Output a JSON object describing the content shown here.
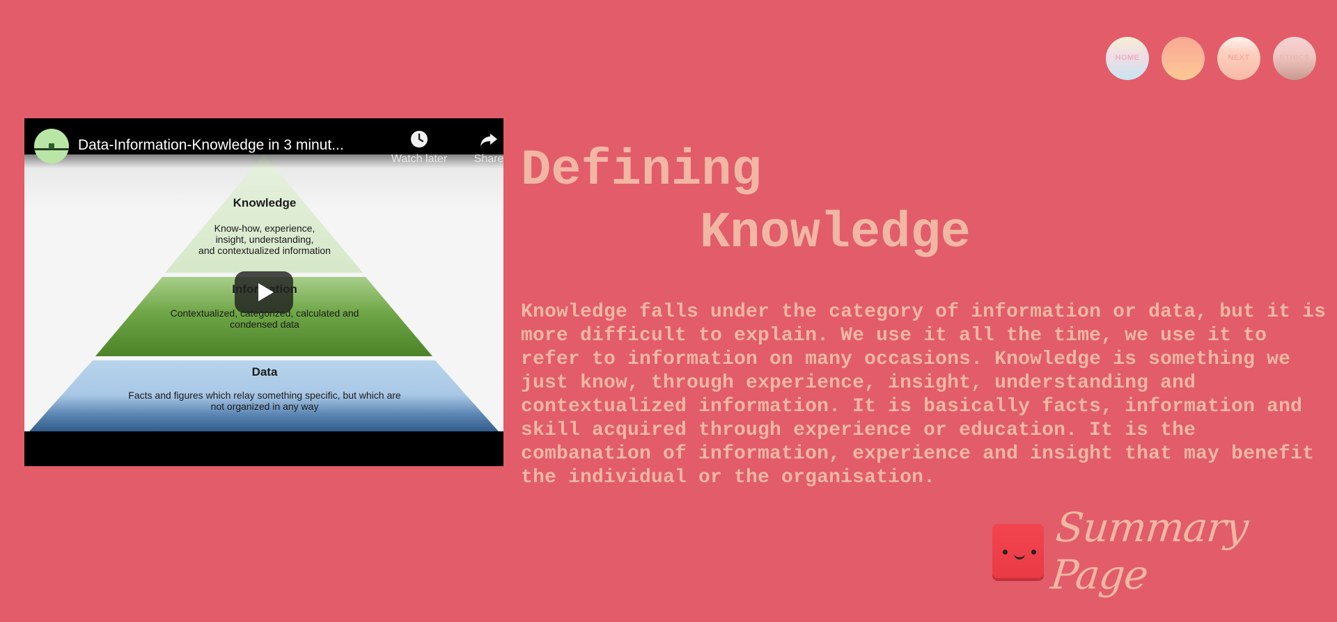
{
  "nav": {
    "items": [
      {
        "label": "HOME"
      },
      {
        "label": ""
      },
      {
        "label": "NEXT"
      },
      {
        "label": "ETHICS"
      }
    ]
  },
  "video": {
    "title": "Data-Information-Knowledge in 3 minut...",
    "watch_later_label": "Watch later",
    "share_label": "Share",
    "pyramid": {
      "knowledge": {
        "title": "Knowledge",
        "desc_lines": [
          "Know-how, experience,",
          "insight, understanding,",
          "and contextualized information"
        ]
      },
      "information": {
        "title": "Information",
        "desc_lines": [
          "Contextualized, categorized, calculated and",
          "condensed data"
        ]
      },
      "data": {
        "title": "Data",
        "desc_lines": [
          "Facts and figures which relay something specific, but which are",
          "not organized in any way"
        ]
      }
    }
  },
  "heading": {
    "line1": "Defining",
    "line2": "Knowledge"
  },
  "body": "Knowledge falls under the category of information or data, but it is more difficult to explain. We use it all the time, we use it to refer to information on many occasions. Knowledge is something we just know, through experience, insight, understanding and contextualized information. It is basically facts, information and skill acquired through experience or education. It is the combanation of information, experience and insight that may benefit the individual or the organisation.",
  "summary": {
    "label": "Summary Page"
  },
  "colors": {
    "background": "#e25c6a",
    "text": "#f2b7a4"
  }
}
